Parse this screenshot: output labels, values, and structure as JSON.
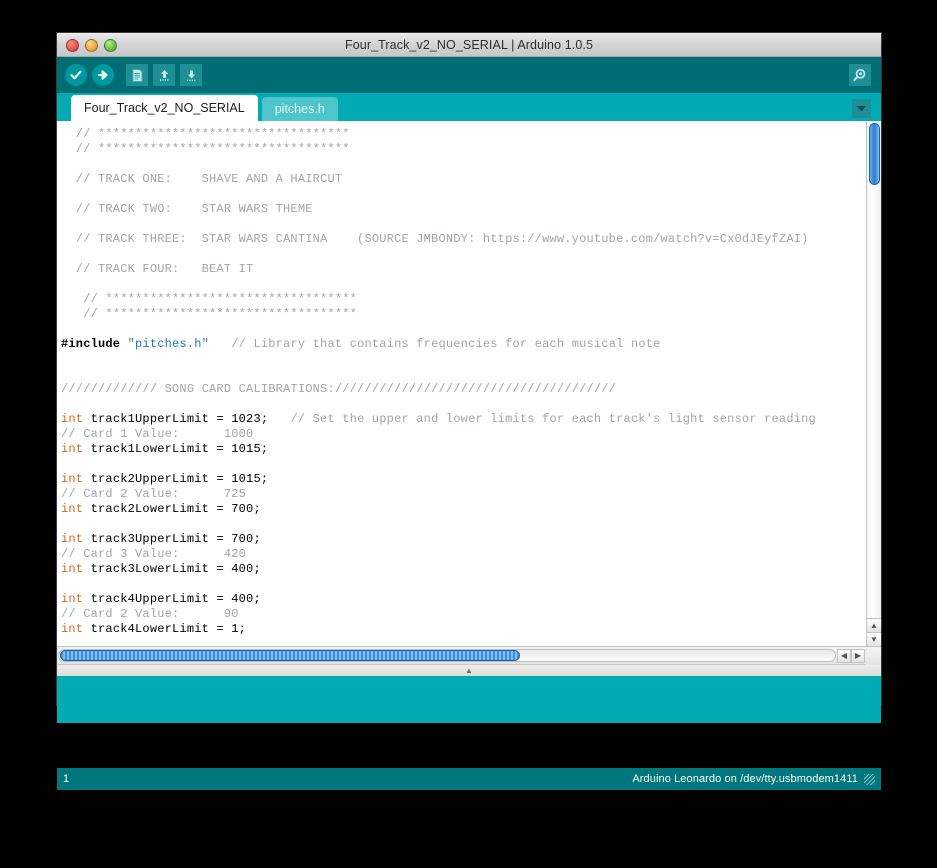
{
  "window": {
    "title": "Four_Track_v2_NO_SERIAL | Arduino 1.0.5",
    "traffic_lights": {
      "close": "close-button",
      "minimize": "minimize-button",
      "maximize": "maximize-button"
    }
  },
  "toolbar": {
    "buttons": [
      {
        "name": "verify",
        "label": "Verify",
        "icon": "checkmark-icon"
      },
      {
        "name": "upload",
        "label": "Upload",
        "icon": "right-arrow-icon"
      },
      {
        "name": "new",
        "label": "New",
        "icon": "document-icon"
      },
      {
        "name": "open",
        "label": "Open",
        "icon": "up-arrow-icon"
      },
      {
        "name": "save",
        "label": "Save",
        "icon": "down-arrow-icon"
      }
    ],
    "serial_monitor": {
      "label": "Serial Monitor",
      "icon": "magnifier-icon"
    }
  },
  "tabs": {
    "items": [
      {
        "label": "Four_Track_v2_NO_SERIAL",
        "active": true
      },
      {
        "label": "pitches.h",
        "active": false
      }
    ],
    "menu_icon": "chevron-down-icon"
  },
  "editor": {
    "lines": [
      [
        {
          "t": "cm",
          "s": "  // **********************************"
        }
      ],
      [
        {
          "t": "cm",
          "s": "  // **********************************"
        }
      ],
      [
        {
          "t": "cm",
          "s": ""
        }
      ],
      [
        {
          "t": "cm",
          "s": "  // TRACK ONE:    SHAVE AND A HAIRCUT"
        }
      ],
      [
        {
          "t": "cm",
          "s": ""
        }
      ],
      [
        {
          "t": "cm",
          "s": "  // TRACK TWO:    STAR WARS THEME"
        }
      ],
      [
        {
          "t": "cm",
          "s": ""
        }
      ],
      [
        {
          "t": "cm",
          "s": "  // TRACK THREE:  STAR WARS CANTINA    (SOURCE JMBONDY: https://www.youtube.com/watch?v=Cx0dJEyfZAI)"
        }
      ],
      [
        {
          "t": "cm",
          "s": ""
        }
      ],
      [
        {
          "t": "cm",
          "s": "  // TRACK FOUR:   BEAT IT"
        }
      ],
      [
        {
          "t": "cm",
          "s": ""
        }
      ],
      [
        {
          "t": "cm",
          "s": "   // **********************************"
        }
      ],
      [
        {
          "t": "cm",
          "s": "   // **********************************"
        }
      ],
      [
        {
          "t": "cm",
          "s": ""
        }
      ],
      [
        {
          "t": "pp",
          "s": "#include "
        },
        {
          "t": "str",
          "s": "\"pitches.h\""
        },
        {
          "t": "cm",
          "s": "   // Library that contains frequencies for each musical note"
        }
      ],
      [
        {
          "t": "cm",
          "s": ""
        }
      ],
      [
        {
          "t": "cm",
          "s": ""
        }
      ],
      [
        {
          "t": "cm",
          "s": "///////////// SONG CARD CALIBRATIONS://////////////////////////////////////"
        }
      ],
      [
        {
          "t": "cm",
          "s": ""
        }
      ],
      [
        {
          "t": "kw",
          "s": "int"
        },
        {
          "t": "",
          "s": " track1UpperLimit = 1023;"
        },
        {
          "t": "cm",
          "s": "   // Set the upper and lower limits for each track's light sensor reading"
        }
      ],
      [
        {
          "t": "cm",
          "s": "// Card 1 Value:      1000"
        }
      ],
      [
        {
          "t": "kw",
          "s": "int"
        },
        {
          "t": "",
          "s": " track1LowerLimit = 1015;"
        }
      ],
      [
        {
          "t": "cm",
          "s": ""
        }
      ],
      [
        {
          "t": "kw",
          "s": "int"
        },
        {
          "t": "",
          "s": " track2UpperLimit = 1015;"
        }
      ],
      [
        {
          "t": "cm",
          "s": "// Card 2 Value:      725"
        }
      ],
      [
        {
          "t": "kw",
          "s": "int"
        },
        {
          "t": "",
          "s": " track2LowerLimit = 700;"
        }
      ],
      [
        {
          "t": "cm",
          "s": ""
        }
      ],
      [
        {
          "t": "kw",
          "s": "int"
        },
        {
          "t": "",
          "s": " track3UpperLimit = 700;"
        }
      ],
      [
        {
          "t": "cm",
          "s": "// Card 3 Value:      420"
        }
      ],
      [
        {
          "t": "kw",
          "s": "int"
        },
        {
          "t": "",
          "s": " track3LowerLimit = 400;"
        }
      ],
      [
        {
          "t": "cm",
          "s": ""
        }
      ],
      [
        {
          "t": "kw",
          "s": "int"
        },
        {
          "t": "",
          "s": " track4UpperLimit = 400;"
        }
      ],
      [
        {
          "t": "cm",
          "s": "// Card 2 Value:      90"
        }
      ],
      [
        {
          "t": "kw",
          "s": "int"
        },
        {
          "t": "",
          "s": " track4LowerLimit = 1;"
        }
      ]
    ]
  },
  "scrollbars": {
    "vertical": {
      "up_arrow": "▲",
      "down_arrow": "▼"
    },
    "horizontal": {
      "left_arrow": "◀",
      "right_arrow": "▶"
    },
    "divider_handle": "▲"
  },
  "statusbar": {
    "line_number": "1",
    "board_info": "Arduino Leonardo on /dev/tty.usbmodem1411"
  },
  "colors": {
    "toolbar_teal": "#006d74",
    "tabbar_teal": "#00abb4",
    "status_teal": "#00767d",
    "inactive_tab": "#4dc5ca",
    "keyword_orange": "#d2691e",
    "string_blue": "#1c7ba8",
    "comment_grey": "#a0a6a6",
    "scroll_blue": "#2e7ccc"
  }
}
